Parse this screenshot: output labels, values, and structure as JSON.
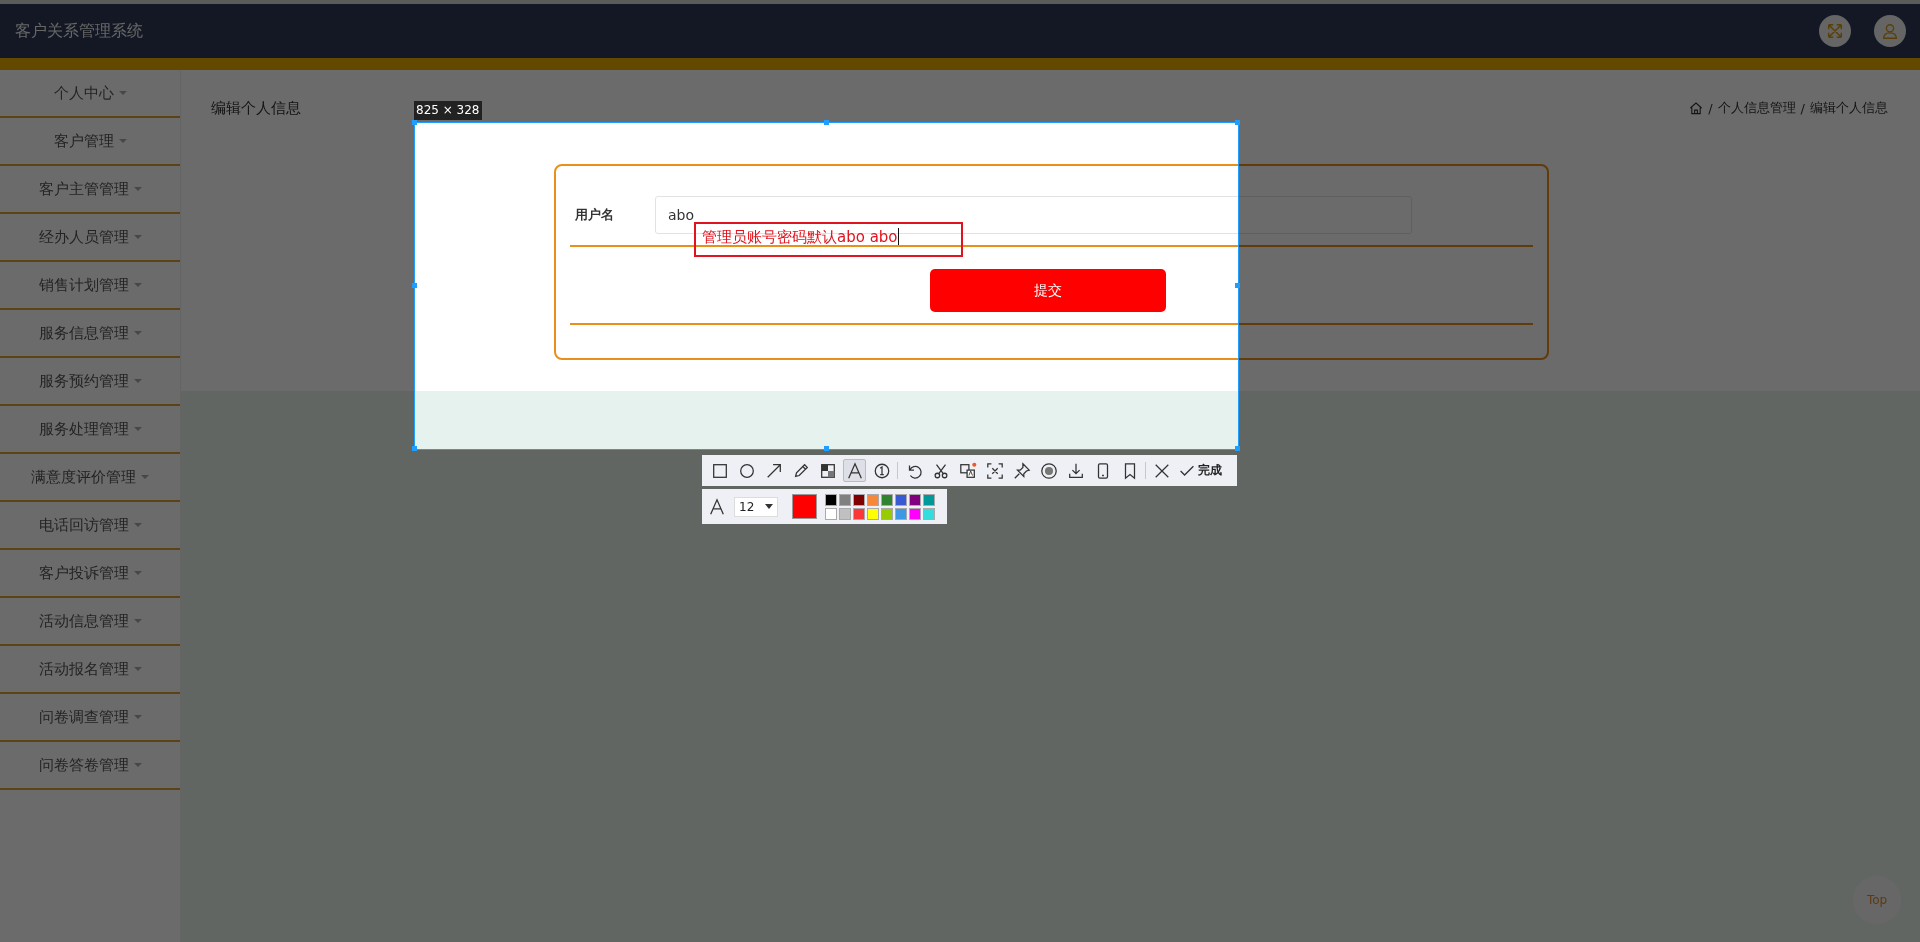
{
  "header": {
    "title": "客户关系管理系统"
  },
  "sidebar": {
    "items": [
      {
        "label": "个人中心"
      },
      {
        "label": "客户管理"
      },
      {
        "label": "客户主管管理"
      },
      {
        "label": "经办人员管理"
      },
      {
        "label": "销售计划管理"
      },
      {
        "label": "服务信息管理"
      },
      {
        "label": "服务预约管理"
      },
      {
        "label": "服务处理管理"
      },
      {
        "label": "满意度评价管理"
      },
      {
        "label": "电话回访管理"
      },
      {
        "label": "客户投诉管理"
      },
      {
        "label": "活动信息管理"
      },
      {
        "label": "活动报名管理"
      },
      {
        "label": "问卷调查管理"
      },
      {
        "label": "问卷答卷管理"
      }
    ]
  },
  "page": {
    "title": "编辑个人信息",
    "breadcrumb": {
      "separator": "/",
      "items": [
        "个人信息管理",
        "编辑个人信息"
      ]
    }
  },
  "form": {
    "fields": [
      {
        "label": "用户名",
        "value": "abo"
      }
    ],
    "submit": "提交"
  },
  "back_to_top": "Top",
  "capture": {
    "size_label": "825 × 328",
    "annotation": "管理员账号密码默认abo abo",
    "tools": [
      {
        "kind": "rectangle",
        "selected": false
      },
      {
        "kind": "ellipse",
        "selected": false
      },
      {
        "kind": "arrow",
        "selected": false
      },
      {
        "kind": "pencil",
        "selected": false
      },
      {
        "kind": "mosaic",
        "selected": false
      },
      {
        "kind": "text",
        "selected": true
      },
      {
        "kind": "number",
        "selected": false
      },
      {
        "kind": "undo",
        "selected": false
      },
      {
        "kind": "cut",
        "selected": false
      },
      {
        "kind": "translate",
        "selected": false
      },
      {
        "kind": "crop",
        "selected": false
      },
      {
        "kind": "pin",
        "selected": false
      },
      {
        "kind": "record",
        "selected": false
      },
      {
        "kind": "download",
        "selected": false
      },
      {
        "kind": "phone",
        "selected": false
      },
      {
        "kind": "bookmark",
        "selected": false
      },
      {
        "kind": "close",
        "selected": false
      }
    ],
    "done_label": "完成",
    "font_size": "12",
    "current": {
      "color": "#ff0000"
    },
    "palette": [
      {
        "color": "#000000"
      },
      {
        "color": "#808080"
      },
      {
        "color": "#800000"
      },
      {
        "color": "#f7883a"
      },
      {
        "color": "#308430"
      },
      {
        "color": "#385ad3"
      },
      {
        "color": "#800080"
      },
      {
        "color": "#009999"
      },
      {
        "color": "#ffffff"
      },
      {
        "color": "#c0c0c0"
      },
      {
        "color": "#fb3838"
      },
      {
        "color": "#ffff00"
      },
      {
        "color": "#99cc00"
      },
      {
        "color": "#3d99e4"
      },
      {
        "color": "#ff00ff"
      },
      {
        "color": "#33dddd"
      }
    ]
  }
}
